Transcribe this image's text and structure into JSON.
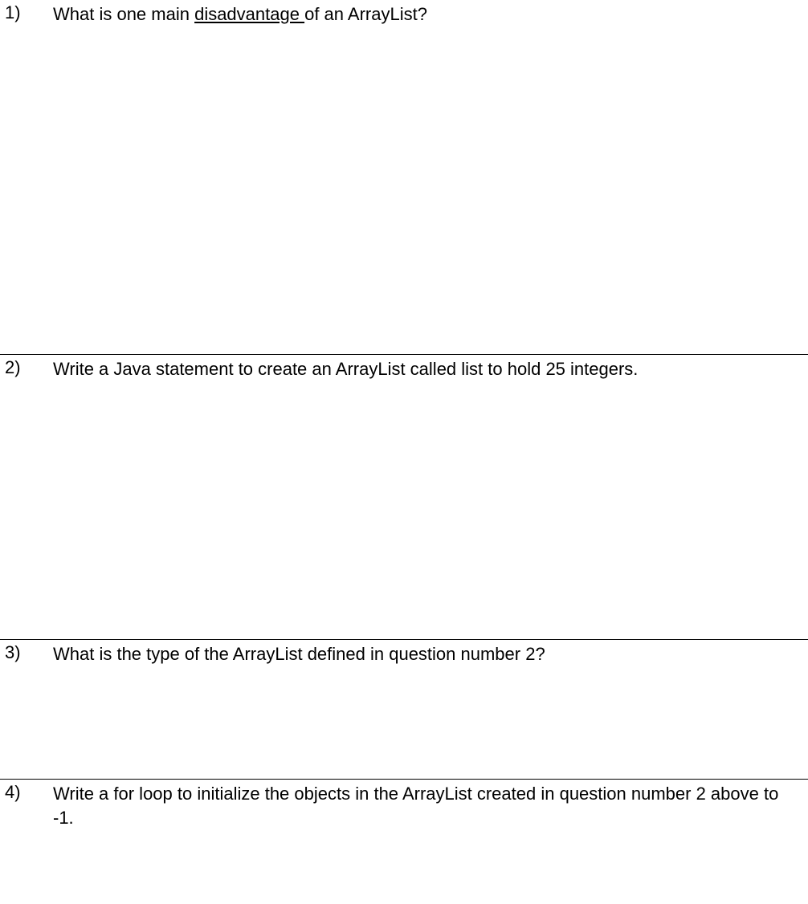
{
  "questions": [
    {
      "number": "1)",
      "text_before": "What is one main ",
      "underlined": "disadvantage ",
      "text_after": "of an ArrayList?"
    },
    {
      "number": "2)",
      "text": "Write a Java statement to create an ArrayList called list to hold 25 integers."
    },
    {
      "number": "3)",
      "text": "What is the type of the ArrayList defined in question number 2?"
    },
    {
      "number": "4)",
      "text": "Write a for loop to initialize the objects in the ArrayList created in question number 2 above to -1."
    }
  ]
}
